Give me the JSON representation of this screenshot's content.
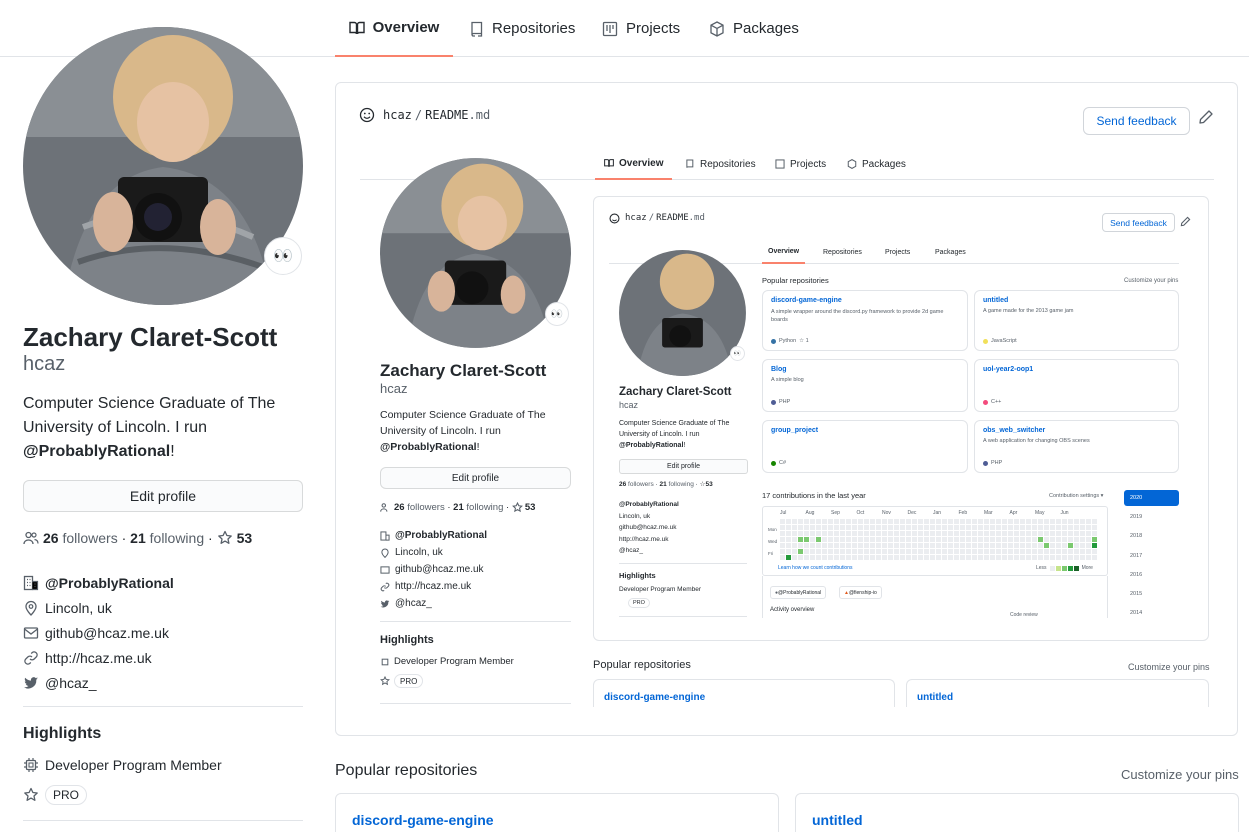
{
  "nav": {
    "tabs": [
      {
        "label": "Overview",
        "icon": "book-icon"
      },
      {
        "label": "Repositories",
        "icon": "repo-icon"
      },
      {
        "label": "Projects",
        "icon": "project-icon"
      },
      {
        "label": "Packages",
        "icon": "package-icon"
      }
    ],
    "active_tab": "Overview"
  },
  "profile": {
    "name": "Zachary Claret-Scott",
    "username": "hcaz",
    "status_emoji": "👀",
    "bio_prefix": "Computer Science Graduate of The University of Lincoln. I run ",
    "bio_org": "@ProbablyRational",
    "bio_suffix": "!",
    "edit_button": "Edit profile",
    "followers_count": "26",
    "followers_label": "followers",
    "separator": "·",
    "following_count": "21",
    "following_label": "following",
    "stars_count": "53",
    "company": "@ProbablyRational",
    "location": "Lincoln, uk",
    "email": "github@hcaz.me.uk",
    "website": "http://hcaz.me.uk",
    "twitter": "@hcaz_"
  },
  "highlights": {
    "title": "Highlights",
    "items": [
      "Developer Program Member"
    ],
    "badge": "PRO"
  },
  "readme": {
    "user": "hcaz",
    "slash": "/",
    "file_name": "README",
    "file_ext": ".md",
    "feedback_button": "Send feedback"
  },
  "popular": {
    "title": "Popular repositories",
    "customize": "Customize your pins",
    "repos": [
      {
        "name": "discord-game-engine",
        "desc": "A simple wrapper around the discord.py framework to provide 2d game boards",
        "lang": "Python",
        "lang_color": "#3572A5",
        "stars": "1"
      },
      {
        "name": "untitled",
        "desc": "A game made for the 2013 game jam",
        "lang": "JavaScript",
        "lang_color": "#f1e05a",
        "stars": ""
      },
      {
        "name": "Blog",
        "desc": "A simple blog",
        "lang": "PHP",
        "lang_color": "#4F5D95",
        "stars": ""
      },
      {
        "name": "uol-year2-oop1",
        "desc": "",
        "lang": "C++",
        "lang_color": "#f34b7d",
        "stars": ""
      },
      {
        "name": "group_project",
        "desc": "",
        "lang": "C#",
        "lang_color": "#178600",
        "stars": ""
      },
      {
        "name": "obs_web_switcher",
        "desc": "A web application for changing OBS scenes",
        "lang": "PHP",
        "lang_color": "#4F5D95",
        "stars": ""
      }
    ]
  },
  "contributions": {
    "title": "17 contributions in the last year",
    "settings": "Contribution settings ▾",
    "months": [
      "Jul",
      "Aug",
      "Sep",
      "Oct",
      "Nov",
      "Dec",
      "Jan",
      "Feb",
      "Mar",
      "Apr",
      "May",
      "Jun"
    ],
    "days": [
      "Mon",
      "Wed",
      "Fri"
    ],
    "learn": "Learn how we count contributions",
    "less": "Less",
    "more": "More",
    "years": [
      "2020",
      "2019",
      "2018",
      "2017",
      "2016",
      "2015",
      "2014"
    ],
    "orgs": [
      "@ProbablyRational",
      "@fienship-io"
    ],
    "activity": "Activity overview",
    "code_review": "Code review"
  },
  "colors": {
    "link": "#0366d6",
    "tab_underline": "#f9826c",
    "border": "#e1e4e8",
    "year_active": "#0366d6"
  }
}
